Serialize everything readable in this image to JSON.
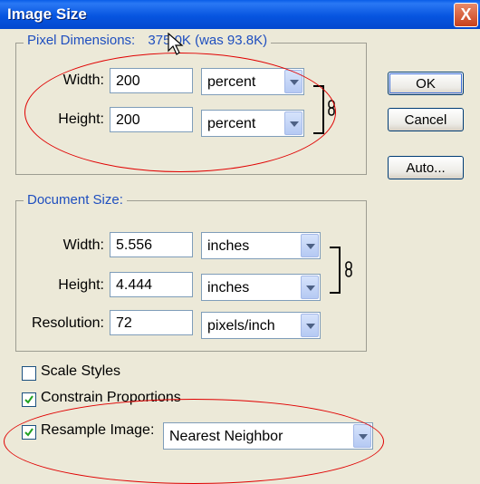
{
  "window": {
    "title": "Image Size",
    "close_glyph": "X"
  },
  "pixel_dimensions": {
    "title": "Pixel Dimensions:",
    "size_info": "375.0K (was 93.8K)",
    "width": {
      "label": "Width:",
      "value": "200",
      "unit": "percent"
    },
    "height": {
      "label": "Height:",
      "value": "200",
      "unit": "percent"
    }
  },
  "document_size": {
    "title": "Document Size:",
    "width": {
      "label": "Width:",
      "value": "5.556",
      "unit": "inches"
    },
    "height": {
      "label": "Height:",
      "value": "4.444",
      "unit": "inches"
    },
    "resolution": {
      "label": "Resolution:",
      "value": "72",
      "unit": "pixels/inch"
    }
  },
  "buttons": {
    "ok": "OK",
    "cancel": "Cancel",
    "auto": "Auto..."
  },
  "options": {
    "scale_styles": {
      "label": "Scale Styles",
      "checked": false
    },
    "constrain_proportions": {
      "label": "Constrain Proportions",
      "checked": true
    },
    "resample_image": {
      "label": "Resample Image:",
      "checked": true,
      "method": "Nearest Neighbor"
    }
  },
  "colors": {
    "titlebar": "#0755e0",
    "group_title": "#1f4fbf",
    "annotation": "#e00000"
  },
  "icons": [
    "close-icon",
    "chain-link-icon",
    "dropdown-arrow-icon",
    "checkmark-icon",
    "mouse-cursor-icon"
  ]
}
